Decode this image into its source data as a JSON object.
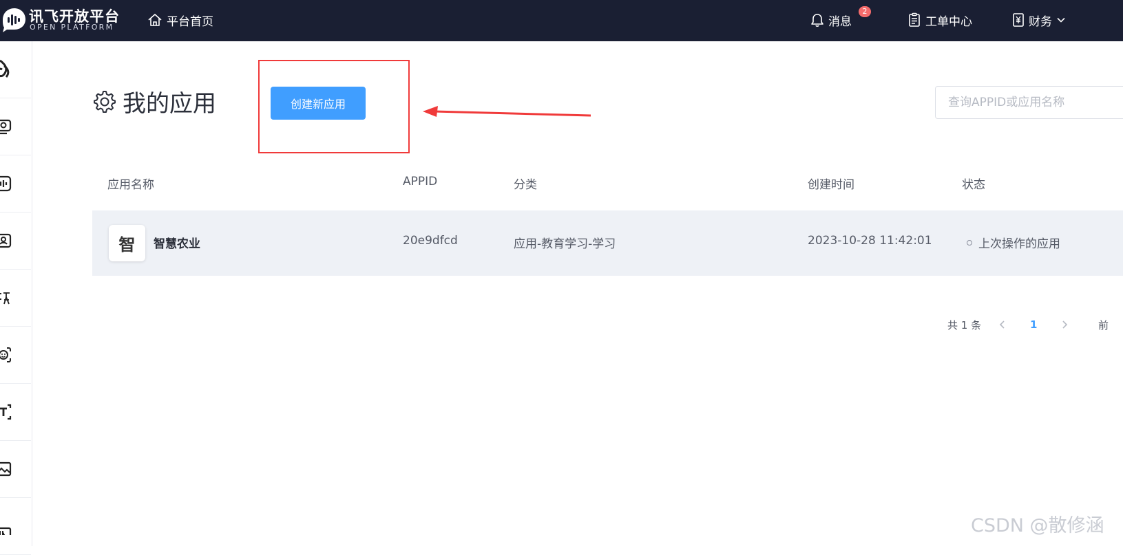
{
  "topbar": {
    "logo_text": "讯飞开放平台",
    "logo_sub": "OPEN PLATFORM",
    "home_label": "平台首页",
    "messages_label": "消息",
    "messages_badge": "2",
    "tickets_label": "工单中心",
    "finance_label": "财务"
  },
  "sidebar": {
    "items": [
      {
        "icon": "spark-icon"
      },
      {
        "icon": "monitor-icon"
      },
      {
        "icon": "speaker-icon"
      },
      {
        "icon": "id-card-icon"
      },
      {
        "icon": "translate-icon"
      },
      {
        "icon": "face-icon"
      },
      {
        "icon": "text-recognition-icon"
      },
      {
        "icon": "image-icon"
      },
      {
        "icon": "nlp-icon"
      }
    ]
  },
  "main": {
    "title": "我的应用",
    "create_button": "创建新应用",
    "search_placeholder": "查询APPID或应用名称"
  },
  "table": {
    "headers": [
      "应用名称",
      "APPID",
      "分类",
      "创建时间",
      "状态"
    ],
    "rows": [
      {
        "icon_char": "智",
        "name": "智慧农业",
        "appid": "20e9dfcd",
        "category": "应用-教育学习-学习",
        "created": "2023-10-28 11:42:01",
        "status": "上次操作的应用"
      }
    ]
  },
  "pagination": {
    "total": "共 1 条",
    "current_page": "1",
    "goto_label": "前"
  },
  "watermark": "CSDN @散修涵",
  "colors": {
    "topbar": "#1a1f33",
    "primary": "#409eff",
    "annotation_red": "#f03a3a",
    "row_highlight": "#eef1f6"
  }
}
